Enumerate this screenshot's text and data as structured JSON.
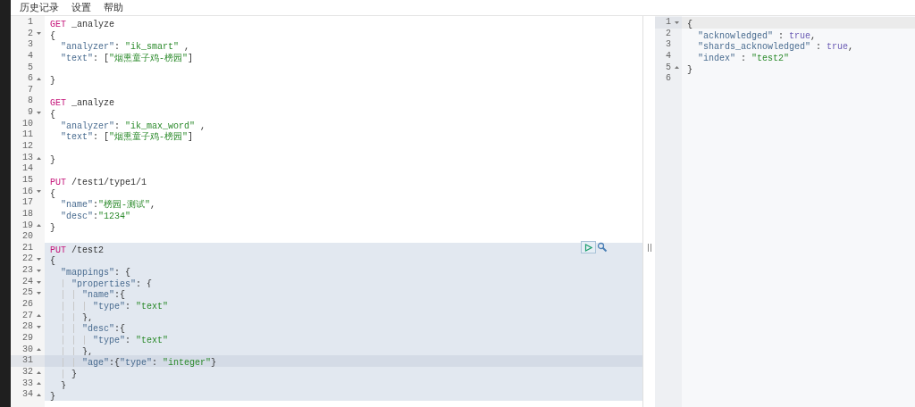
{
  "menu": [
    {
      "label": "历史记录"
    },
    {
      "label": "设置"
    },
    {
      "label": "帮助"
    }
  ],
  "editor": {
    "lines": [
      {
        "number": "1",
        "selected": false,
        "current": false,
        "tokens": [
          {
            "kind": "method",
            "text": "GET"
          },
          {
            "kind": "text",
            "text": " _analyze"
          }
        ]
      },
      {
        "number": "2",
        "expanded": true,
        "selected": false,
        "current": false,
        "tokens": [
          {
            "kind": "text",
            "text": "{"
          }
        ]
      },
      {
        "number": "3",
        "selected": false,
        "current": false,
        "tokens": [
          {
            "kind": "key",
            "text": "  \"analyzer\""
          },
          {
            "kind": "text",
            "text": ": "
          },
          {
            "kind": "string",
            "text": "\"ik_smart\""
          },
          {
            "kind": "text",
            "text": " ,"
          }
        ]
      },
      {
        "number": "4",
        "selected": false,
        "current": false,
        "tokens": [
          {
            "kind": "key",
            "text": "  \"text\""
          },
          {
            "kind": "text",
            "text": ": ["
          },
          {
            "kind": "string",
            "text": "\"烟熏童子鸡-榜园\""
          },
          {
            "kind": "text",
            "text": "]"
          }
        ]
      },
      {
        "number": "5",
        "selected": false,
        "current": false
      },
      {
        "number": "6",
        "expanded": false,
        "selected": false,
        "current": false,
        "tokens": [
          {
            "kind": "text",
            "text": "}"
          }
        ]
      },
      {
        "number": "7",
        "selected": false,
        "current": false
      },
      {
        "number": "8",
        "selected": false,
        "current": false,
        "tokens": [
          {
            "kind": "method",
            "text": "GET"
          },
          {
            "kind": "text",
            "text": " _analyze"
          }
        ]
      },
      {
        "number": "9",
        "expanded": true,
        "selected": false,
        "current": false,
        "tokens": [
          {
            "kind": "text",
            "text": "{"
          }
        ]
      },
      {
        "number": "10",
        "selected": false,
        "current": false,
        "tokens": [
          {
            "kind": "key",
            "text": "  \"analyzer\""
          },
          {
            "kind": "text",
            "text": ": "
          },
          {
            "kind": "string",
            "text": "\"ik_max_word\""
          },
          {
            "kind": "text",
            "text": " ,"
          }
        ]
      },
      {
        "number": "11",
        "selected": false,
        "current": false,
        "tokens": [
          {
            "kind": "key",
            "text": "  \"text\""
          },
          {
            "kind": "text",
            "text": ": ["
          },
          {
            "kind": "string",
            "text": "\"烟熏童子鸡-榜园\""
          },
          {
            "kind": "text",
            "text": "]"
          }
        ]
      },
      {
        "number": "12",
        "selected": false,
        "current": false
      },
      {
        "number": "13",
        "expanded": false,
        "selected": false,
        "current": false,
        "tokens": [
          {
            "kind": "text",
            "text": "}"
          }
        ]
      },
      {
        "number": "14",
        "selected": false,
        "current": false
      },
      {
        "number": "15",
        "selected": false,
        "current": false,
        "tokens": [
          {
            "kind": "method",
            "text": "PUT"
          },
          {
            "kind": "text",
            "text": " /test1/type1/1"
          }
        ]
      },
      {
        "number": "16",
        "expanded": true,
        "selected": false,
        "current": false,
        "tokens": [
          {
            "kind": "text",
            "text": "{"
          }
        ]
      },
      {
        "number": "17",
        "selected": false,
        "current": false,
        "tokens": [
          {
            "kind": "key",
            "text": "  \"name\""
          },
          {
            "kind": "text",
            "text": ":"
          },
          {
            "kind": "string",
            "text": "\"榜园-测试\""
          },
          {
            "kind": "text",
            "text": ","
          }
        ]
      },
      {
        "number": "18",
        "selected": false,
        "current": false,
        "tokens": [
          {
            "kind": "key",
            "text": "  \"desc\""
          },
          {
            "kind": "text",
            "text": ":"
          },
          {
            "kind": "string",
            "text": "\"1234\""
          }
        ]
      },
      {
        "number": "19",
        "expanded": false,
        "selected": false,
        "current": false,
        "tokens": [
          {
            "kind": "text",
            "text": "}"
          }
        ]
      },
      {
        "number": "20",
        "selected": false,
        "current": false
      },
      {
        "number": "21",
        "selected": true,
        "current": false,
        "tokens": [
          {
            "kind": "method",
            "text": "PUT"
          },
          {
            "kind": "text",
            "text": " /test2"
          }
        ]
      },
      {
        "number": "22",
        "expanded": true,
        "selected": true,
        "current": false,
        "tokens": [
          {
            "kind": "text",
            "text": "{"
          }
        ]
      },
      {
        "number": "23",
        "expanded": true,
        "selected": true,
        "current": false,
        "tokens": [
          {
            "kind": "key",
            "text": "  \"mappings\""
          },
          {
            "kind": "text",
            "text": ": {"
          }
        ]
      },
      {
        "number": "24",
        "expanded": true,
        "selected": true,
        "current": false,
        "tokens": [
          {
            "kind": "key",
            "text": "    \"properties\""
          },
          {
            "kind": "text",
            "text": ": {"
          }
        ]
      },
      {
        "number": "25",
        "expanded": true,
        "selected": true,
        "current": false,
        "tokens": [
          {
            "kind": "key",
            "text": "      \"name\""
          },
          {
            "kind": "text",
            "text": ":{"
          }
        ]
      },
      {
        "number": "26",
        "selected": true,
        "current": false,
        "tokens": [
          {
            "kind": "key",
            "text": "        \"type\""
          },
          {
            "kind": "text",
            "text": ": "
          },
          {
            "kind": "string",
            "text": "\"text\""
          }
        ]
      },
      {
        "number": "27",
        "expanded": false,
        "selected": true,
        "current": false,
        "tokens": [
          {
            "kind": "text",
            "text": "      },"
          }
        ]
      },
      {
        "number": "28",
        "expanded": true,
        "selected": true,
        "current": false,
        "tokens": [
          {
            "kind": "key",
            "text": "      \"desc\""
          },
          {
            "kind": "text",
            "text": ":{"
          }
        ]
      },
      {
        "number": "29",
        "selected": true,
        "current": false,
        "tokens": [
          {
            "kind": "key",
            "text": "        \"type\""
          },
          {
            "kind": "text",
            "text": ": "
          },
          {
            "kind": "string",
            "text": "\"text\""
          }
        ]
      },
      {
        "number": "30",
        "expanded": false,
        "selected": true,
        "current": false,
        "tokens": [
          {
            "kind": "text",
            "text": "      },"
          }
        ]
      },
      {
        "number": "31",
        "selected": true,
        "current": true,
        "tokens": [
          {
            "kind": "key",
            "text": "      \"age\""
          },
          {
            "kind": "text",
            "text": ":{"
          },
          {
            "kind": "key",
            "text": "\"type\""
          },
          {
            "kind": "text",
            "text": ": "
          },
          {
            "kind": "string",
            "text": "\"integer\""
          },
          {
            "kind": "text",
            "text": "}"
          }
        ]
      },
      {
        "number": "32",
        "expanded": false,
        "selected": true,
        "current": false,
        "tokens": [
          {
            "kind": "text",
            "text": "    }"
          }
        ]
      },
      {
        "number": "33",
        "expanded": false,
        "selected": true,
        "current": false,
        "tokens": [
          {
            "kind": "text",
            "text": "  }"
          }
        ]
      },
      {
        "number": "34",
        "expanded": false,
        "selected": true,
        "current": false,
        "tokens": [
          {
            "kind": "text",
            "text": "}"
          }
        ]
      }
    ]
  },
  "output": {
    "lines": [
      {
        "number": "1",
        "expanded": true,
        "current": true,
        "tokens": [
          {
            "kind": "text",
            "text": "{"
          }
        ]
      },
      {
        "number": "2",
        "current": false,
        "tokens": [
          {
            "kind": "key",
            "text": "  \"acknowledged\""
          },
          {
            "kind": "text",
            "text": " : "
          },
          {
            "kind": "keyword",
            "text": "true"
          },
          {
            "kind": "text",
            "text": ","
          }
        ]
      },
      {
        "number": "3",
        "current": false,
        "tokens": [
          {
            "kind": "key",
            "text": "  \"shards_acknowledged\""
          },
          {
            "kind": "text",
            "text": " : "
          },
          {
            "kind": "keyword",
            "text": "true"
          },
          {
            "kind": "text",
            "text": ","
          }
        ]
      },
      {
        "number": "4",
        "current": false,
        "tokens": [
          {
            "kind": "key",
            "text": "  \"index\""
          },
          {
            "kind": "text",
            "text": " : "
          },
          {
            "kind": "string",
            "text": "\"test2\""
          }
        ]
      },
      {
        "number": "5",
        "expanded": false,
        "current": false,
        "tokens": [
          {
            "kind": "text",
            "text": "}"
          }
        ]
      },
      {
        "number": "6",
        "current": false
      }
    ]
  }
}
